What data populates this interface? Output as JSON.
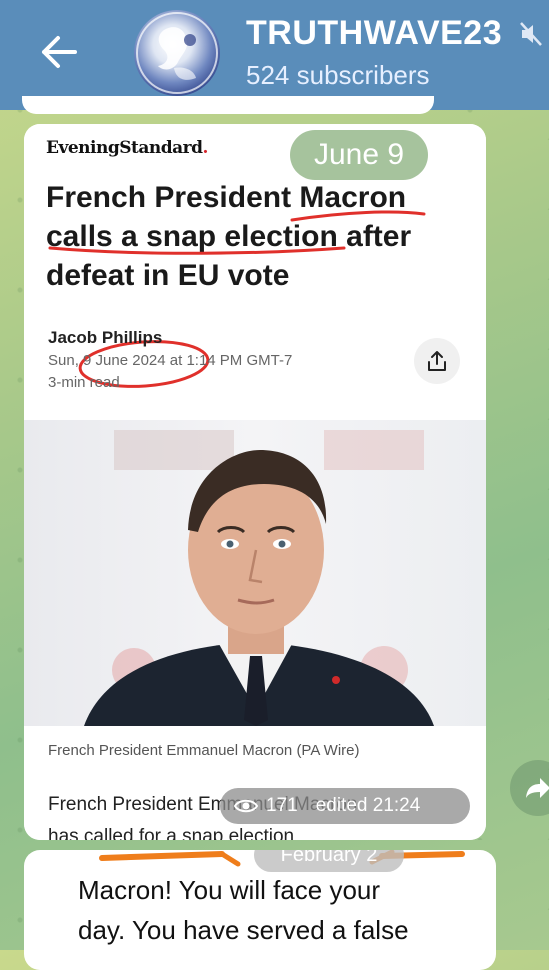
{
  "header": {
    "title": "TRUTHWAVE23",
    "subscribers": "524 subscribers",
    "colors": {
      "bar": "#5a8dba",
      "text": "#ffffff"
    }
  },
  "post1": {
    "date_overlay": "June 9",
    "publication": "EveningStandard",
    "publication_dot": ".",
    "headline": "French President Macron calls a snap election after defeat in EU vote",
    "author": "Jacob Phillips",
    "dateline": "Sun, 9 June 2024 at 1:14 PM GMT-7",
    "read_time": "3-min read",
    "caption": "French President Emmanuel Macron (PA Wire)",
    "body_start": "French President Emmanuel Macron",
    "body_next": "has called for a snap election",
    "views": "171",
    "edited": "edited 21:24"
  },
  "post2": {
    "date_overlay": "February 2",
    "text_line1": "Macron! You will face your",
    "text_line2": "day.  You have served a false"
  },
  "icons": [
    "back-arrow-icon",
    "mute-icon",
    "share-icon",
    "eye-icon",
    "forward-icon"
  ]
}
